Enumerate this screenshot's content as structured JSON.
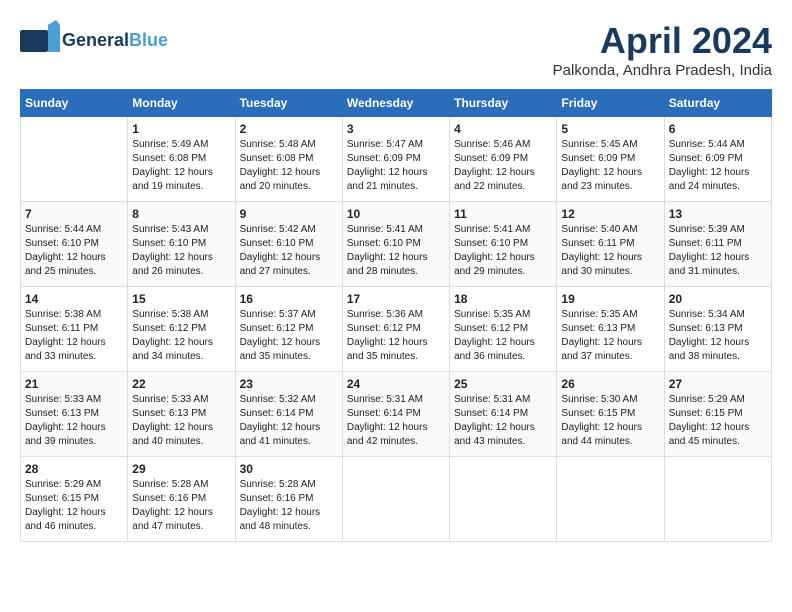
{
  "header": {
    "logo_general": "General",
    "logo_blue": "Blue",
    "month": "April 2024",
    "location": "Palkonda, Andhra Pradesh, India"
  },
  "days_of_week": [
    "Sunday",
    "Monday",
    "Tuesday",
    "Wednesday",
    "Thursday",
    "Friday",
    "Saturday"
  ],
  "weeks": [
    [
      {
        "day": "",
        "text": ""
      },
      {
        "day": "1",
        "text": "Sunrise: 5:49 AM\nSunset: 6:08 PM\nDaylight: 12 hours\nand 19 minutes."
      },
      {
        "day": "2",
        "text": "Sunrise: 5:48 AM\nSunset: 6:08 PM\nDaylight: 12 hours\nand 20 minutes."
      },
      {
        "day": "3",
        "text": "Sunrise: 5:47 AM\nSunset: 6:09 PM\nDaylight: 12 hours\nand 21 minutes."
      },
      {
        "day": "4",
        "text": "Sunrise: 5:46 AM\nSunset: 6:09 PM\nDaylight: 12 hours\nand 22 minutes."
      },
      {
        "day": "5",
        "text": "Sunrise: 5:45 AM\nSunset: 6:09 PM\nDaylight: 12 hours\nand 23 minutes."
      },
      {
        "day": "6",
        "text": "Sunrise: 5:44 AM\nSunset: 6:09 PM\nDaylight: 12 hours\nand 24 minutes."
      }
    ],
    [
      {
        "day": "7",
        "text": "Sunrise: 5:44 AM\nSunset: 6:10 PM\nDaylight: 12 hours\nand 25 minutes."
      },
      {
        "day": "8",
        "text": "Sunrise: 5:43 AM\nSunset: 6:10 PM\nDaylight: 12 hours\nand 26 minutes."
      },
      {
        "day": "9",
        "text": "Sunrise: 5:42 AM\nSunset: 6:10 PM\nDaylight: 12 hours\nand 27 minutes."
      },
      {
        "day": "10",
        "text": "Sunrise: 5:41 AM\nSunset: 6:10 PM\nDaylight: 12 hours\nand 28 minutes."
      },
      {
        "day": "11",
        "text": "Sunrise: 5:41 AM\nSunset: 6:10 PM\nDaylight: 12 hours\nand 29 minutes."
      },
      {
        "day": "12",
        "text": "Sunrise: 5:40 AM\nSunset: 6:11 PM\nDaylight: 12 hours\nand 30 minutes."
      },
      {
        "day": "13",
        "text": "Sunrise: 5:39 AM\nSunset: 6:11 PM\nDaylight: 12 hours\nand 31 minutes."
      }
    ],
    [
      {
        "day": "14",
        "text": "Sunrise: 5:38 AM\nSunset: 6:11 PM\nDaylight: 12 hours\nand 33 minutes."
      },
      {
        "day": "15",
        "text": "Sunrise: 5:38 AM\nSunset: 6:12 PM\nDaylight: 12 hours\nand 34 minutes."
      },
      {
        "day": "16",
        "text": "Sunrise: 5:37 AM\nSunset: 6:12 PM\nDaylight: 12 hours\nand 35 minutes."
      },
      {
        "day": "17",
        "text": "Sunrise: 5:36 AM\nSunset: 6:12 PM\nDaylight: 12 hours\nand 35 minutes."
      },
      {
        "day": "18",
        "text": "Sunrise: 5:35 AM\nSunset: 6:12 PM\nDaylight: 12 hours\nand 36 minutes."
      },
      {
        "day": "19",
        "text": "Sunrise: 5:35 AM\nSunset: 6:13 PM\nDaylight: 12 hours\nand 37 minutes."
      },
      {
        "day": "20",
        "text": "Sunrise: 5:34 AM\nSunset: 6:13 PM\nDaylight: 12 hours\nand 38 minutes."
      }
    ],
    [
      {
        "day": "21",
        "text": "Sunrise: 5:33 AM\nSunset: 6:13 PM\nDaylight: 12 hours\nand 39 minutes."
      },
      {
        "day": "22",
        "text": "Sunrise: 5:33 AM\nSunset: 6:13 PM\nDaylight: 12 hours\nand 40 minutes."
      },
      {
        "day": "23",
        "text": "Sunrise: 5:32 AM\nSunset: 6:14 PM\nDaylight: 12 hours\nand 41 minutes."
      },
      {
        "day": "24",
        "text": "Sunrise: 5:31 AM\nSunset: 6:14 PM\nDaylight: 12 hours\nand 42 minutes."
      },
      {
        "day": "25",
        "text": "Sunrise: 5:31 AM\nSunset: 6:14 PM\nDaylight: 12 hours\nand 43 minutes."
      },
      {
        "day": "26",
        "text": "Sunrise: 5:30 AM\nSunset: 6:15 PM\nDaylight: 12 hours\nand 44 minutes."
      },
      {
        "day": "27",
        "text": "Sunrise: 5:29 AM\nSunset: 6:15 PM\nDaylight: 12 hours\nand 45 minutes."
      }
    ],
    [
      {
        "day": "28",
        "text": "Sunrise: 5:29 AM\nSunset: 6:15 PM\nDaylight: 12 hours\nand 46 minutes."
      },
      {
        "day": "29",
        "text": "Sunrise: 5:28 AM\nSunset: 6:16 PM\nDaylight: 12 hours\nand 47 minutes."
      },
      {
        "day": "30",
        "text": "Sunrise: 5:28 AM\nSunset: 6:16 PM\nDaylight: 12 hours\nand 48 minutes."
      },
      {
        "day": "",
        "text": ""
      },
      {
        "day": "",
        "text": ""
      },
      {
        "day": "",
        "text": ""
      },
      {
        "day": "",
        "text": ""
      }
    ]
  ]
}
